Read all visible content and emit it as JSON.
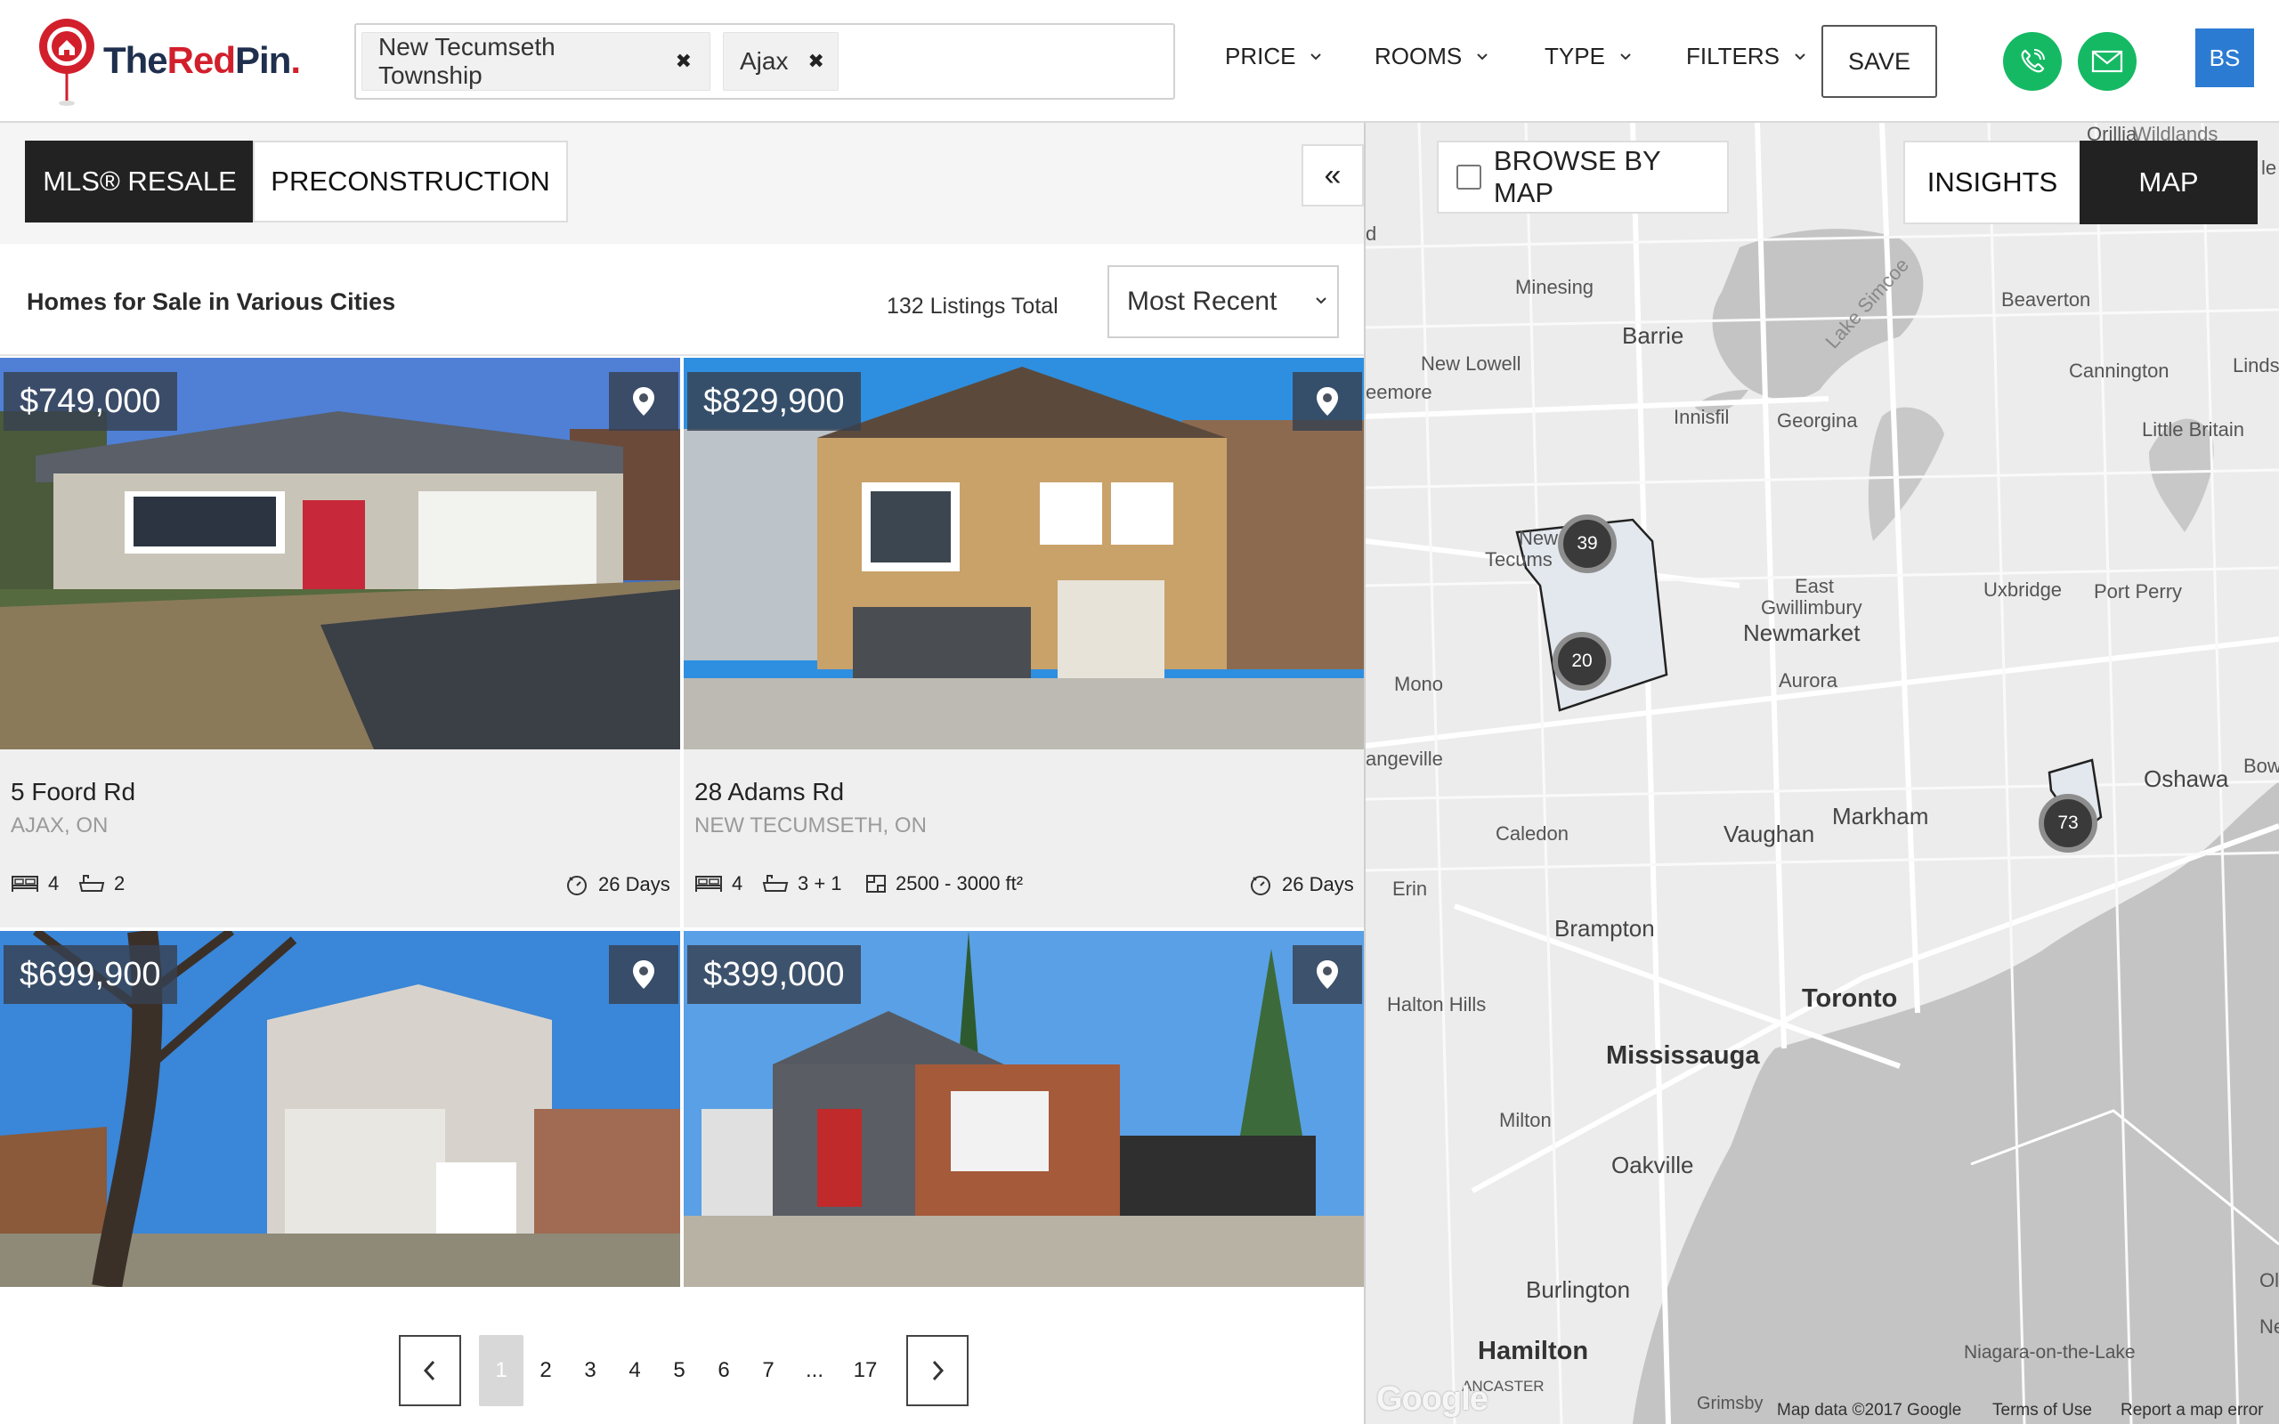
{
  "brand": {
    "logo_part1": "The",
    "logo_part2": "Red",
    "logo_part3": "Pin",
    "logo_dot": "."
  },
  "search": {
    "chips": [
      {
        "label": "New Tecumseth Township"
      },
      {
        "label": "Ajax"
      }
    ]
  },
  "filters": {
    "price": "PRICE",
    "rooms": "ROOMS",
    "type": "TYPE",
    "more": "FILTERS",
    "save": "SAVE"
  },
  "user": {
    "initials": "BS"
  },
  "tabs": {
    "resale": "MLS® RESALE",
    "preconstruction": "PRECONSTRUCTION",
    "collapse": "«"
  },
  "list": {
    "title": "Homes for Sale in Various Cities",
    "total": "132 Listings Total",
    "sort": "Most Recent"
  },
  "listings": [
    {
      "price": "$749,000",
      "address": "5 Foord Rd",
      "city": "AJAX, ON",
      "beds": "4",
      "baths": "2",
      "sqft": "",
      "days": "26 Days"
    },
    {
      "price": "$829,900",
      "address": "28 Adams Rd",
      "city": "NEW TECUMSETH, ON",
      "beds": "4",
      "baths": "3 + 1",
      "sqft": "2500 - 3000 ft²",
      "days": "26 Days"
    },
    {
      "price": "$699,900"
    },
    {
      "price": "$399,000"
    }
  ],
  "pagination": {
    "pages": [
      "1",
      "2",
      "3",
      "4",
      "5",
      "6",
      "7",
      "...",
      "17"
    ],
    "current": "1"
  },
  "map": {
    "browse_label": "BROWSE BY MAP",
    "insights": "INSIGHTS",
    "map": "MAP",
    "places": {
      "orillia": "Orillia",
      "wildlands": "Wildlands",
      "minesing": "Minesing",
      "barrie": "Barrie",
      "lake_simcoe": "Lake Simcoe",
      "beaverton": "Beaverton",
      "new_lowell": "New Lowell",
      "eemore": "eemore",
      "innisfil": "Innisfil",
      "georgina": "Georgina",
      "cannington": "Cannington",
      "linds": "Linds",
      "little_britain": "Little Britain",
      "new_tecums_1": "New",
      "new_tecums_2": "Tecums",
      "east_gwillimbury_1": "East",
      "east_gwillimbury_2": "Gwillimbury",
      "newmarket": "Newmarket",
      "uxbridge": "Uxbridge",
      "port_perry": "Port Perry",
      "mono": "Mono",
      "aurora": "Aurora",
      "angeville": "angeville",
      "oshawa": "Oshawa",
      "bow": "Bow",
      "caledon": "Caledon",
      "vaughan": "Vaughan",
      "markham": "Markham",
      "erin": "Erin",
      "brampton": "Brampton",
      "halton_hills": "Halton Hills",
      "toronto": "Toronto",
      "mississauga": "Mississauga",
      "milton": "Milton",
      "oakville": "Oakville",
      "burlington": "Burlington",
      "hamilton": "Hamilton",
      "ancaster": "ANCASTER",
      "grimsby": "Grimsby",
      "niagara": "Niagara-on-the-Lake",
      "ol": "Ol",
      "ne": "Ne",
      "d": "d",
      "le": "le"
    },
    "clusters": [
      "39",
      "20",
      "73"
    ],
    "footer": {
      "data": "Map data ©2017 Google",
      "terms": "Terms of Use",
      "report": "Report a map error"
    },
    "google": "Google"
  },
  "colors": {
    "brand_red": "#d21f2c",
    "brand_navy": "#1f2f4d",
    "contact_green": "#15b964",
    "avatar_blue": "#2b7bd3"
  }
}
